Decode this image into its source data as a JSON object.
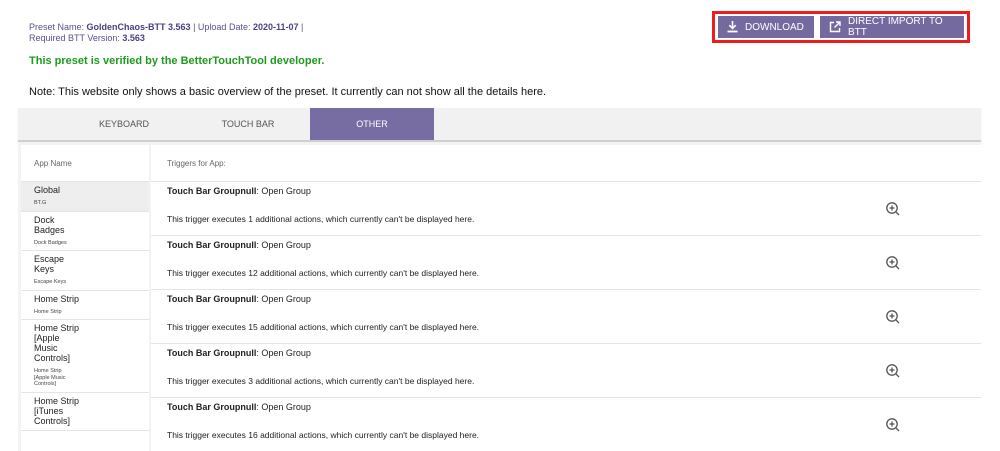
{
  "meta": {
    "preset_label": "Preset Name:",
    "preset_name": "GoldenChaos-BTT 3.563",
    "sep": " | ",
    "upload_label": "Upload Date:",
    "upload_date": "2020-11-07",
    "sep2": " |",
    "required_label": "Required BTT Version:",
    "required_version": "3.563"
  },
  "verified_text": "This preset is verified by the BetterTouchTool developer.",
  "note_text": "Note: This website only shows a basic overview of the preset. It currently can not show all the details here.",
  "buttons": {
    "download_label": "DOWNLOAD",
    "download_icon": "download-icon",
    "import_label": "DIRECT IMPORT TO BTT",
    "import_icon": "external-link-icon"
  },
  "tabs": [
    {
      "label": "KEYBOARD",
      "active": false
    },
    {
      "label": "TOUCH BAR",
      "active": false
    },
    {
      "label": "OTHER",
      "active": true
    }
  ],
  "sidebar": {
    "header": "App Name",
    "items": [
      {
        "name": "Global",
        "sub": "BT.G",
        "selected": true
      },
      {
        "name": "Dock\nBadges",
        "sub": "Dock Badges",
        "selected": false
      },
      {
        "name": "Escape\nKeys",
        "sub": "Escape Keys",
        "selected": false
      },
      {
        "name": "Home Strip",
        "sub": "Home Strip",
        "selected": false
      },
      {
        "name": "Home Strip\n[Apple\nMusic\nControls]",
        "sub": "Home Strip\n[Apple Music\nControls]",
        "selected": false
      },
      {
        "name": "Home Strip\n[iTunes\nControls]",
        "sub": "",
        "selected": false
      }
    ]
  },
  "content": {
    "header": "Triggers for App:",
    "triggers": [
      {
        "bold": "Touch Bar Groupnull",
        "rest": ": Open Group",
        "desc": "This trigger executes 1 additional actions, which currently can't be displayed here."
      },
      {
        "bold": "Touch Bar Groupnull",
        "rest": ": Open Group",
        "desc": "This trigger executes 12 additional actions, which currently can't be displayed here."
      },
      {
        "bold": "Touch Bar Groupnull",
        "rest": ": Open Group",
        "desc": "This trigger executes 15 additional actions, which currently can't be displayed here."
      },
      {
        "bold": "Touch Bar Groupnull",
        "rest": ": Open Group",
        "desc": "This trigger executes 3 additional actions, which currently can't be displayed here."
      },
      {
        "bold": "Touch Bar Groupnull",
        "rest": ": Open Group",
        "desc": "This trigger executes 16 additional actions, which currently can't be displayed here."
      }
    ],
    "expand_icon": "zoom-in-icon"
  },
  "colors": {
    "accent": "#746aa0",
    "verified": "#1f9a1f",
    "highlight_border": "#ee1c1c"
  }
}
